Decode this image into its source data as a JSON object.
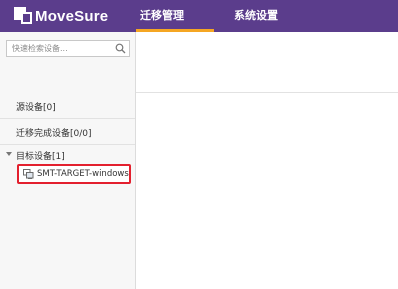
{
  "app": {
    "brand": "MoveSure"
  },
  "nav": {
    "tabs": [
      {
        "label": "迁移管理",
        "active": true
      },
      {
        "label": "系统设置",
        "active": false
      }
    ]
  },
  "sidebar": {
    "search": {
      "placeholder": "快速检索设备...",
      "value": "",
      "icon": "search-icon"
    },
    "sections": [
      {
        "label": "源设备[0]"
      },
      {
        "label": "迁移完成设备[0/0]"
      }
    ],
    "target_group": {
      "label": "目标设备[1]",
      "expanded": true,
      "devices": [
        {
          "label": "SMT-TARGET-windows",
          "icon": "windows-device-icon",
          "highlighted": true
        }
      ]
    }
  },
  "colors": {
    "topbar": "#5b3d8c",
    "active_tab_underline": "#f5a623",
    "highlight_border": "#e3202e"
  }
}
